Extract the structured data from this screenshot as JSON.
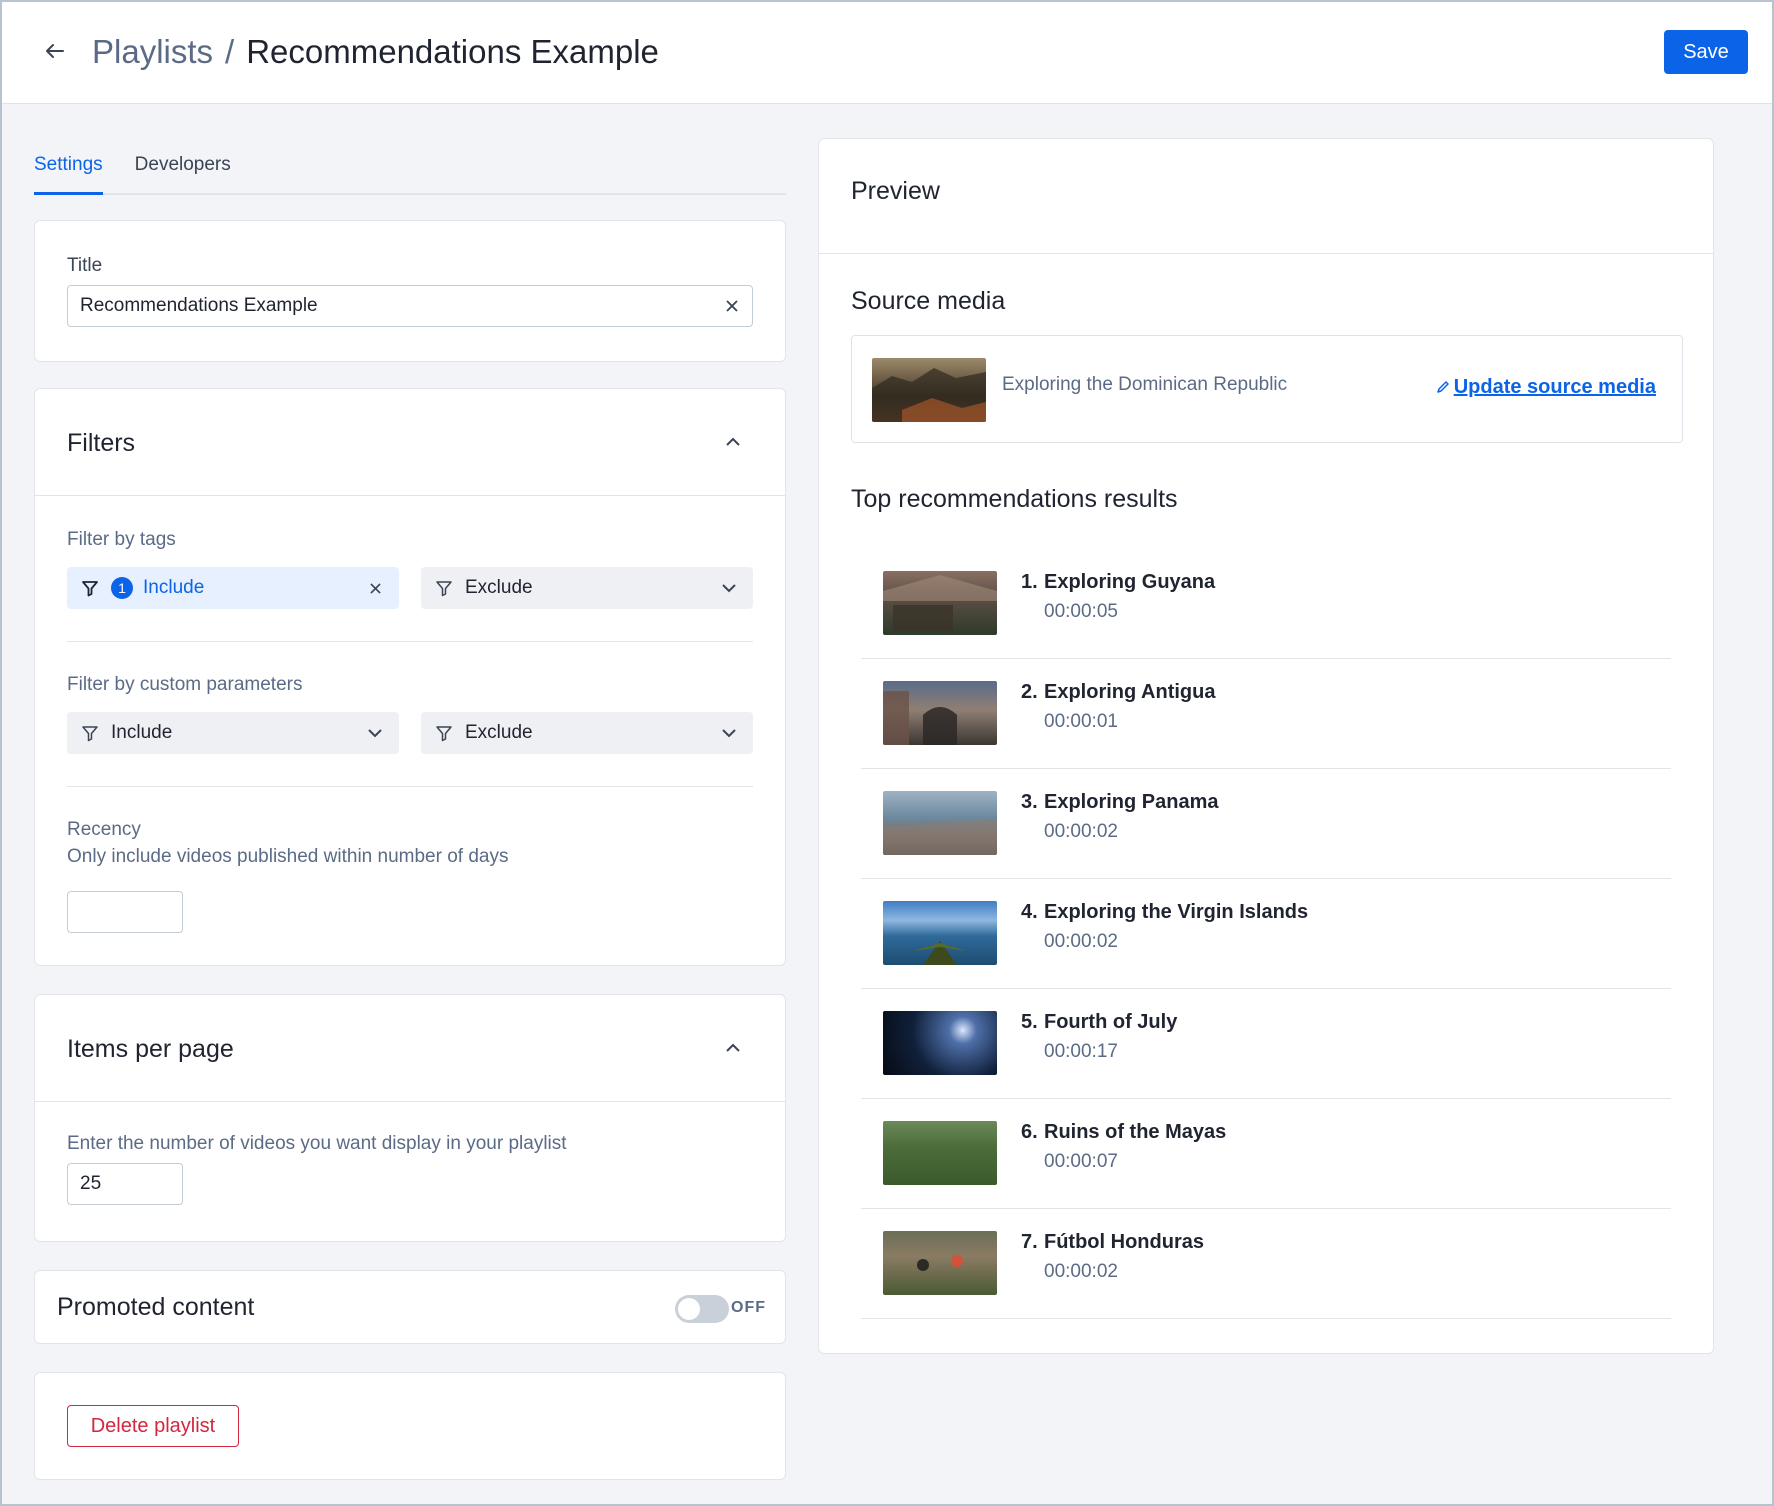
{
  "header": {
    "breadcrumb_parent": "Playlists",
    "breadcrumb_sep": "/",
    "breadcrumb_current": "Recommendations Example",
    "save_label": "Save"
  },
  "tabs": [
    {
      "label": "Settings",
      "active": true
    },
    {
      "label": "Developers",
      "active": false
    }
  ],
  "title_card": {
    "label": "Title",
    "value": "Recommendations Example"
  },
  "filters": {
    "title": "Filters",
    "tags_label": "Filter by tags",
    "tags_include": {
      "label": "Include",
      "count": "1"
    },
    "tags_exclude": {
      "label": "Exclude"
    },
    "custom_label": "Filter by custom parameters",
    "custom_include": {
      "label": "Include"
    },
    "custom_exclude": {
      "label": "Exclude"
    },
    "recency_label": "Recency",
    "recency_hint": "Only include videos published within number of days",
    "recency_value": ""
  },
  "items_per_page": {
    "title": "Items per page",
    "hint": "Enter the number of videos you want display in your playlist",
    "value": "25"
  },
  "promoted": {
    "title": "Promoted content",
    "state": "OFF"
  },
  "danger": {
    "delete_label": "Delete playlist"
  },
  "preview": {
    "title": "Preview",
    "source_title": "Source media",
    "source_name": "Exploring the Dominican Republic",
    "update_label": "Update source media",
    "results_title": "Top recommendations results",
    "results": [
      {
        "index": "1.",
        "title": "Exploring Guyana",
        "duration": "00:00:05"
      },
      {
        "index": "2.",
        "title": "Exploring Antigua",
        "duration": "00:00:01"
      },
      {
        "index": "3.",
        "title": "Exploring Panama",
        "duration": "00:00:02"
      },
      {
        "index": "4.",
        "title": "Exploring the Virgin Islands",
        "duration": "00:00:02"
      },
      {
        "index": "5.",
        "title": "Fourth of July",
        "duration": "00:00:17"
      },
      {
        "index": "6.",
        "title": "Ruins of the Mayas",
        "duration": "00:00:07"
      },
      {
        "index": "7.",
        "title": "Fútbol Honduras",
        "duration": "00:00:02"
      }
    ]
  },
  "colors": {
    "accent": "#0b64e8",
    "danger": "#d4263e",
    "background": "#f3f4f7"
  }
}
